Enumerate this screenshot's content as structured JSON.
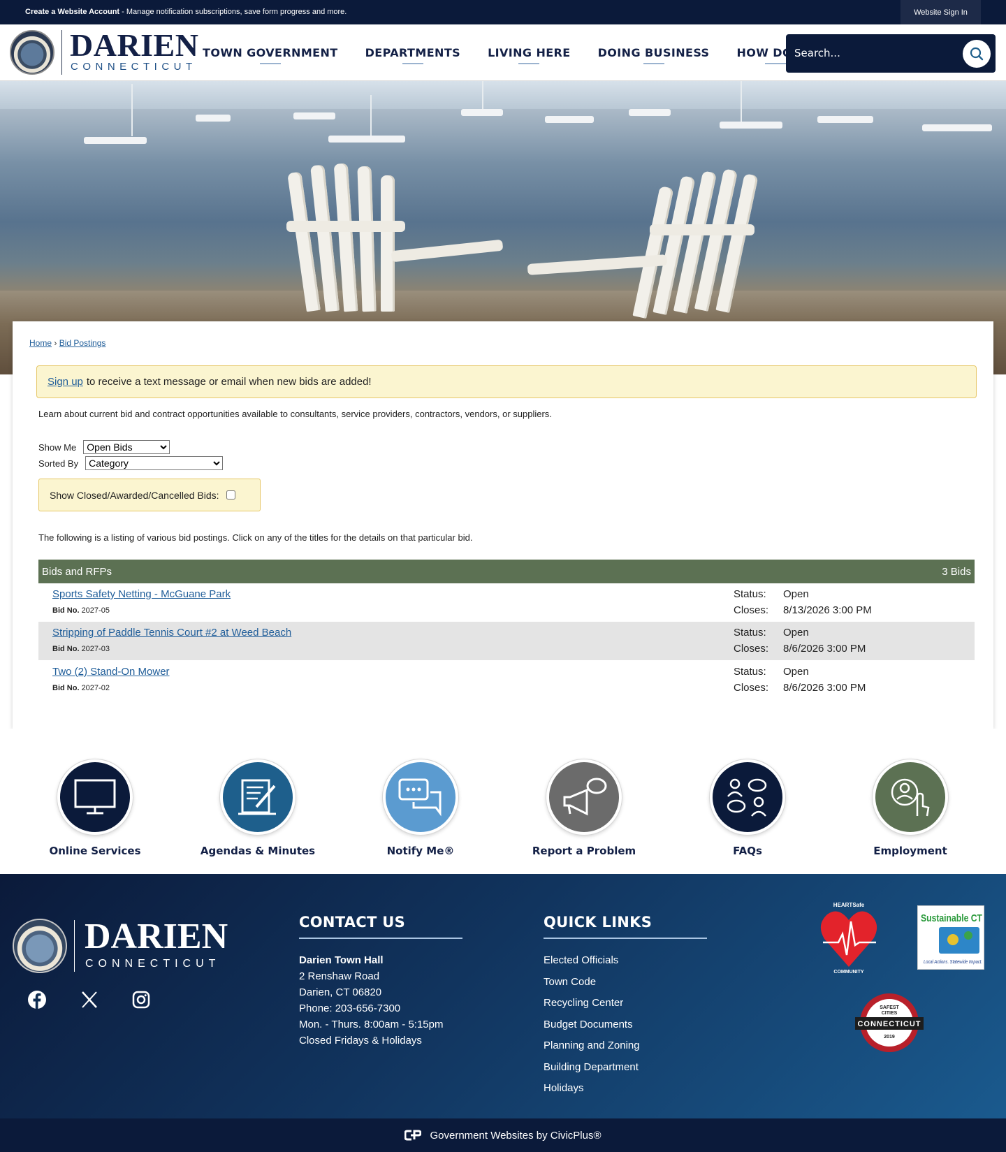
{
  "topbar": {
    "create_link": "Create a Website Account",
    "create_text": " - Manage notification subscriptions, save form progress and more.",
    "signin": "Website Sign In"
  },
  "logo": {
    "title": "DARIEN",
    "subtitle": "CONNECTICUT"
  },
  "nav": {
    "items": [
      "TOWN GOVERNMENT",
      "DEPARTMENTS",
      "LIVING HERE",
      "DOING BUSINESS",
      "HOW DO I..."
    ]
  },
  "search": {
    "placeholder": "Search..."
  },
  "breadcrumb": {
    "home": "Home",
    "separator": "›",
    "current": "Bid Postings"
  },
  "alert": {
    "link": "Sign up",
    "text": "to receive a text message or email when new bids are added!"
  },
  "intro": "Learn about current bid and contract opportunities available to consultants, service providers, contractors, vendors, or suppliers.",
  "filters": {
    "show_me_label": "Show Me",
    "show_me_value": "Open Bids",
    "sorted_by_label": "Sorted By",
    "sorted_by_value": "Category",
    "closed_label": "Show Closed/Awarded/Cancelled Bids:"
  },
  "listing_note": "The following is a listing of various bid postings. Click on any of the titles for the details on that particular bid.",
  "bids_table": {
    "header": "Bids and RFPs",
    "count": "3 Bids",
    "bid_no_label": "Bid No.",
    "status_label": "Status:",
    "closes_label": "Closes:",
    "rows": [
      {
        "title": "Sports Safety Netting - McGuane Park",
        "bid_no": "2027-05",
        "status": "Open",
        "closes": "8/13/2026 3:00 PM"
      },
      {
        "title": "Stripping of Paddle Tennis Court #2 at Weed Beach",
        "bid_no": "2027-03",
        "status": "Open",
        "closes": "8/6/2026 3:00 PM"
      },
      {
        "title": "Two (2) Stand-On Mower",
        "bid_no": "2027-02",
        "status": "Open",
        "closes": "8/6/2026 3:00 PM"
      }
    ]
  },
  "quick_links": [
    {
      "label": "Online Services",
      "icon": "monitor-icon",
      "color": "#0b1a3a"
    },
    {
      "label": "Agendas & Minutes",
      "icon": "document-pen-icon",
      "color": "#1e5f8c"
    },
    {
      "label": "Notify Me®",
      "icon": "chat-bubbles-icon",
      "color": "#5b9bd0"
    },
    {
      "label": "Report a Problem",
      "icon": "megaphone-icon",
      "color": "#6b6b6b"
    },
    {
      "label": "FAQs",
      "icon": "people-chat-icon",
      "color": "#0b1a3a"
    },
    {
      "label": "Employment",
      "icon": "person-hand-icon",
      "color": "#5c7153"
    }
  ],
  "footer": {
    "logo_title": "DARIEN",
    "logo_subtitle": "CONNECTICUT",
    "contact_heading": "CONTACT US",
    "contact": {
      "name": "Darien Town Hall",
      "address1": "2 Renshaw Road",
      "address2": "Darien, CT 06820",
      "phone": "Phone: 203-656-7300",
      "hours": "Mon. - Thurs. 8:00am - 5:15pm",
      "closed": "Closed Fridays & Holidays"
    },
    "links_heading": "QUICK LINKS",
    "links": [
      "Elected Officials",
      "Town Code",
      "Recycling Center",
      "Budget Documents",
      "Planning and Zoning",
      "Building Department",
      "Holidays"
    ],
    "badges": {
      "heart_top": "HEARTSafe",
      "heart_bottom": "COMMUNITY",
      "sct_title": "Sustainable CT",
      "sct_tag": "Local Actions. Statewide Impact.",
      "safe_line1": "SAFEST",
      "safe_line2": "CITIES",
      "safe_banner": "CONNECTICUT",
      "safe_year": "2019"
    },
    "powered_by": "Government Websites by CivicPlus®"
  },
  "colors": {
    "navy": "#0b1a3a",
    "accent_blue": "#1e4f86",
    "table_green": "#5c7153",
    "alert_bg": "#fbf5d0"
  }
}
